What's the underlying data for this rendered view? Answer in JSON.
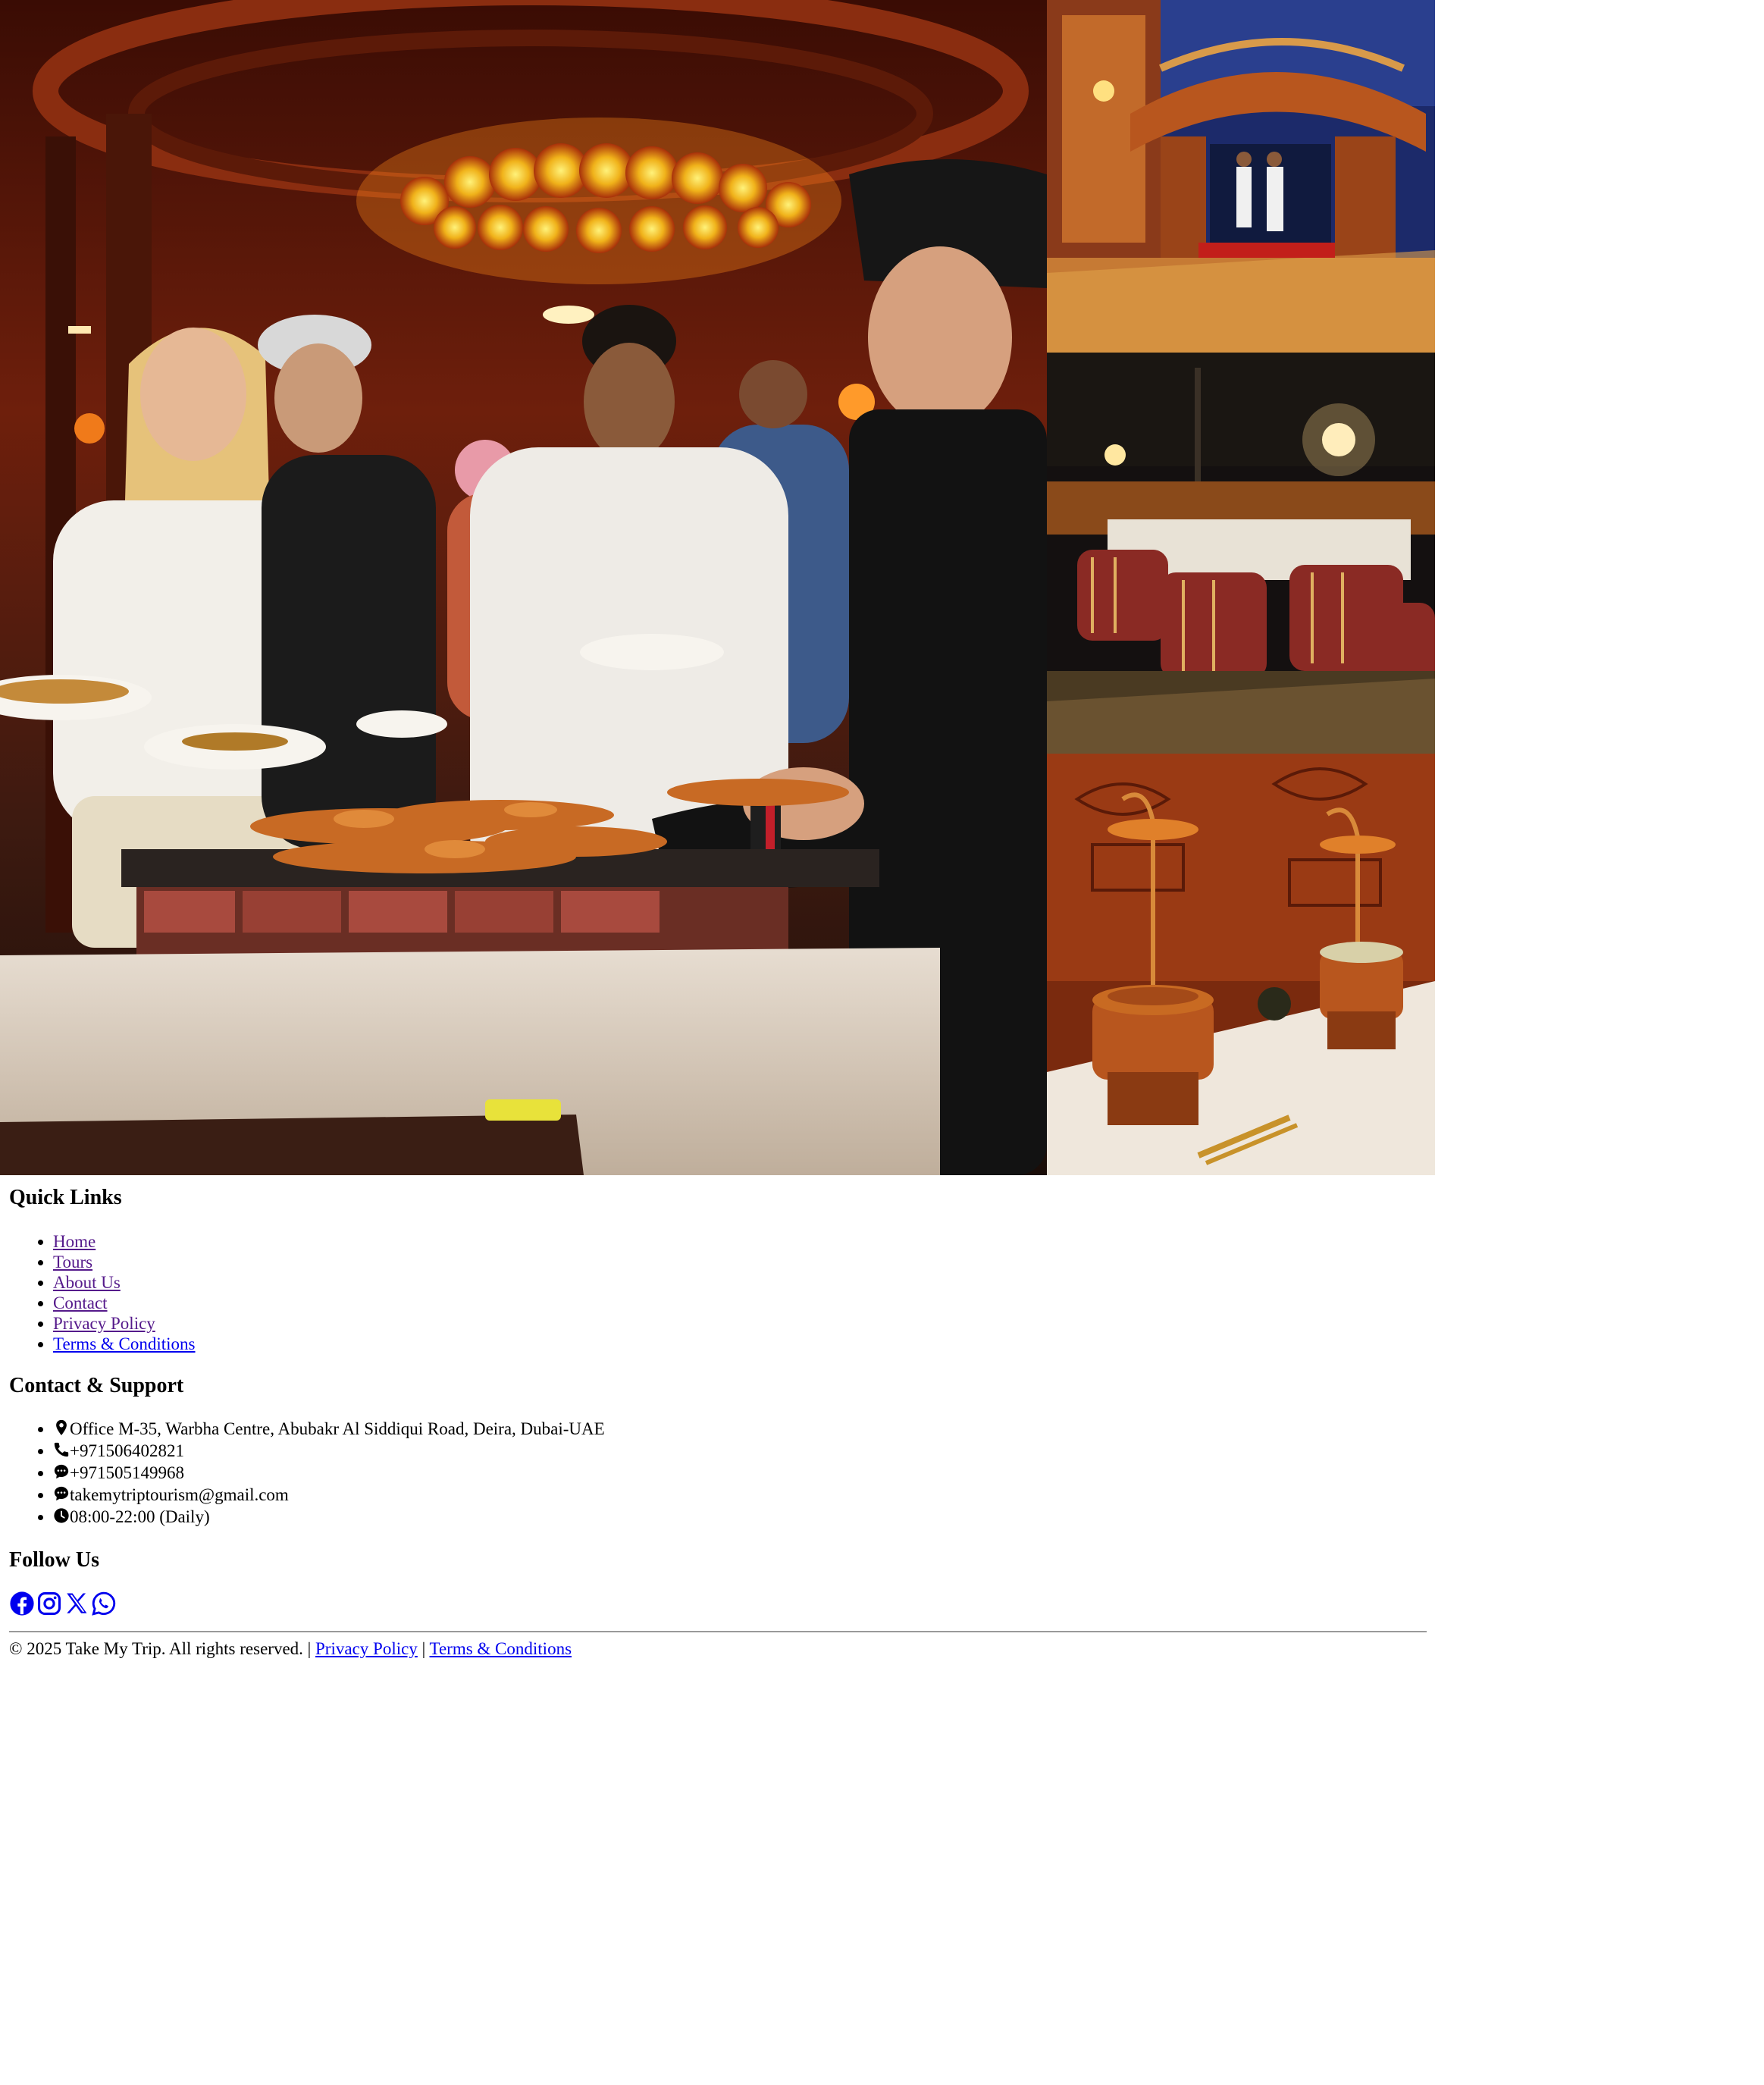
{
  "gallery": {
    "images": [
      {
        "icon": "bbq-buffet-photo"
      },
      {
        "icon": "camp-entrance-arch-photo"
      },
      {
        "icon": "camp-seating-arena-photo"
      },
      {
        "icon": "copper-buffet-station-photo"
      }
    ]
  },
  "footer": {
    "quick_links": {
      "title": "Quick Links",
      "items": [
        {
          "label": "Home"
        },
        {
          "label": "Tours"
        },
        {
          "label": "About Us"
        },
        {
          "label": "Contact"
        },
        {
          "label": "Privacy Policy"
        },
        {
          "label": "Terms & Conditions"
        }
      ]
    },
    "contact": {
      "title": "Contact & Support",
      "items": [
        {
          "icon": "location-pin-icon",
          "text": "Office M-35, Warbha Centre, Abubakr Al Siddiqui Road, Deira, Dubai-UAE"
        },
        {
          "icon": "phone-icon",
          "text": "+971506402821"
        },
        {
          "icon": "chat-icon",
          "text": "+971505149968"
        },
        {
          "icon": "chat-icon",
          "text": "takemytriptourism@gmail.com"
        },
        {
          "icon": "clock-icon",
          "text": "08:00-22:00 (Daily)"
        }
      ]
    },
    "follow": {
      "title": "Follow Us",
      "icons": [
        "facebook-icon",
        "instagram-icon",
        "x-icon",
        "whatsapp-icon"
      ]
    },
    "bottom": {
      "copyright": "© 2025 Take My Trip. All rights reserved.",
      "separator": "|",
      "privacy_label": "Privacy Policy",
      "terms_label": "Terms & Conditions"
    },
    "colors": {
      "link": "#0000ee",
      "visited_link": "#551a8b",
      "rule": "#9a9a9a"
    }
  }
}
